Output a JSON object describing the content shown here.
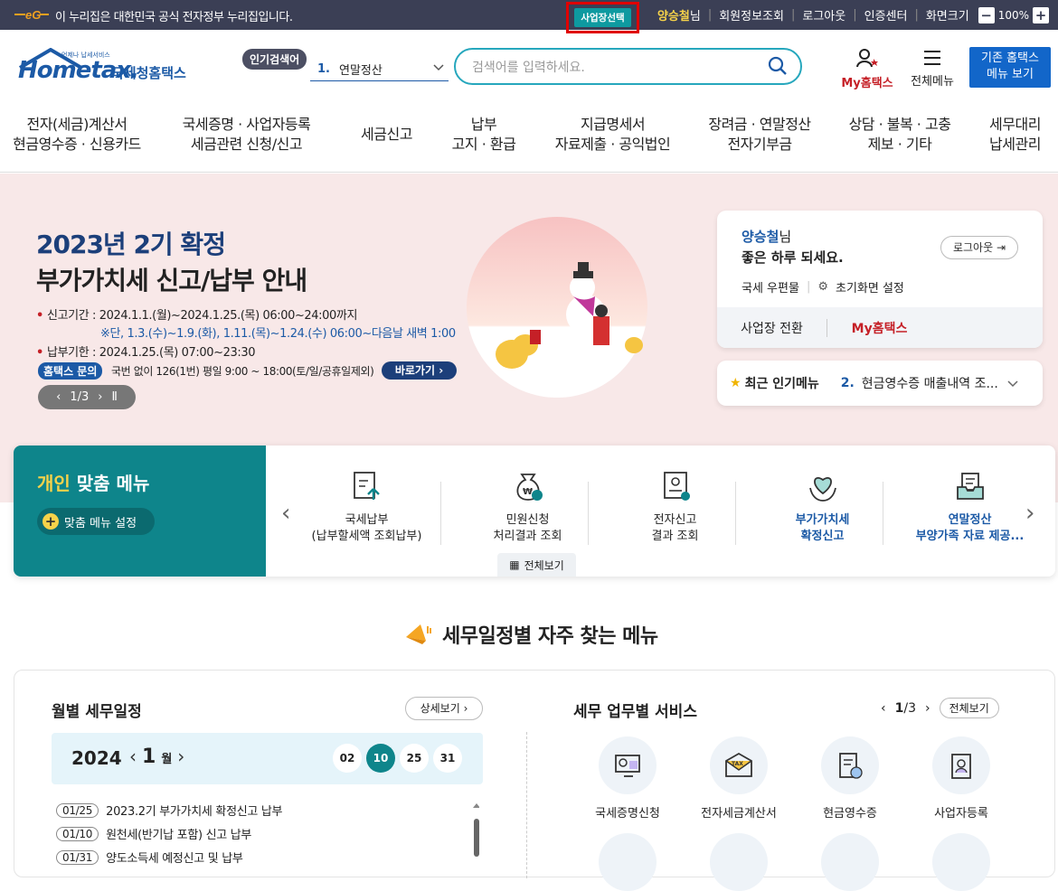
{
  "topbar": {
    "gov_notice": "이 누리집은 대한민국 공식 전자정부 누리집입니다.",
    "biz_select": "사업장선택",
    "user_name": "양승철",
    "user_suffix": "님",
    "links": [
      "회원정보조회",
      "로그아웃",
      "인증센터",
      "화면크기"
    ],
    "zoom": "100%",
    "zoom_minus": "−",
    "zoom_plus": "+"
  },
  "header": {
    "logo_sub": "언제나 납세서비스",
    "logo_main": "Hometax.",
    "logo_name": "국세청홈택스",
    "popular_badge": "인기검색어",
    "popular_num": "1.",
    "popular_term": "연말정산",
    "search_placeholder": "검색어를 입력하세요.",
    "myhometax": "My홈택스",
    "all_menu": "전체메뉴",
    "old_home_line1": "기존 홈택스",
    "old_home_line2": "메뉴 보기"
  },
  "gnb": [
    {
      "l1": "전자(세금)계산서",
      "l2": "현금영수증 · 신용카드"
    },
    {
      "l1": "국세증명 · 사업자등록",
      "l2": "세금관련 신청/신고"
    },
    {
      "l1": "세금신고",
      "l2": ""
    },
    {
      "l1": "납부",
      "l2": "고지 · 환급"
    },
    {
      "l1": "지급명세서",
      "l2": "자료제출 · 공익법인"
    },
    {
      "l1": "장려금 · 연말정산",
      "l2": "전자기부금"
    },
    {
      "l1": "상담 · 불복 · 고충",
      "l2": "제보 · 기타"
    },
    {
      "l1": "세무대리",
      "l2": "납세관리"
    }
  ],
  "banner": {
    "title1": "2023년 2기 확정",
    "title2": "부가가치세 신고/납부 안내",
    "period": "신고기간 : 2024.1.1.(월)~2024.1.25.(목) 06:00~24:00까지",
    "period_note": "※단, 1.3.(수)~1.9.(화), 1.11.(목)~1.24.(수) 06:00~다음날 새벽 1:00",
    "deadline": "납부기한 : 2024.1.25.(목) 07:00~23:30",
    "inquiry_badge": "홈택스 문의",
    "inquiry_text": "국번 없이 126(1번) 평일 9:00 ~ 18:00(토/일/공휴일제외)",
    "go_button": "바로가기",
    "pager": "1/3"
  },
  "userbox": {
    "name": "양승철",
    "suffix": "님",
    "greeting": "좋은 하루 되세요.",
    "logout": "로그아웃",
    "postbox": "국세 우편물",
    "init_setting": "초기화면 설정",
    "switch_biz": "사업장 전환",
    "myhometax": "My홈택스"
  },
  "recent": {
    "title": "최근 인기메뉴",
    "num": "2.",
    "item": "현금영수증 매출내역 조..."
  },
  "personal_menu": {
    "title_hl": "개인",
    "title_rest": " 맞춤 메뉴",
    "setting": "맞춤 메뉴 설정",
    "all_view": "전체보기",
    "items": [
      {
        "l1": "국세납부",
        "l2": "(납부할세액 조회납부)"
      },
      {
        "l1": "민원신청",
        "l2": "처리결과 조회"
      },
      {
        "l1": "전자신고",
        "l2": "결과 조회"
      },
      {
        "l1": "부가가치세",
        "l2": "확정신고"
      },
      {
        "l1": "연말정산",
        "l2": "부양가족 자료 제공..."
      }
    ]
  },
  "section": {
    "title": "세무일정별 자주 찾는 메뉴"
  },
  "calendar": {
    "title": "월별 세무일정",
    "detail": "상세보기",
    "year": "2024",
    "month": "1",
    "month_unit": "월",
    "days": [
      "02",
      "10",
      "25",
      "31"
    ],
    "selected_day": "10",
    "schedule": [
      {
        "date": "01/25",
        "text": "2023.2기 부가가치세 확정신고 납부"
      },
      {
        "date": "01/10",
        "text": "원천세(반기납 포함) 신고 납부"
      },
      {
        "date": "01/31",
        "text": "양도소득세 예정신고 및 납부"
      }
    ]
  },
  "services": {
    "title": "세무 업무별 서비스",
    "page": "1",
    "total": "/3",
    "all_view": "전체보기",
    "items": [
      "국세증명신청",
      "전자세금계산서",
      "현금영수증",
      "사업자등록"
    ]
  }
}
